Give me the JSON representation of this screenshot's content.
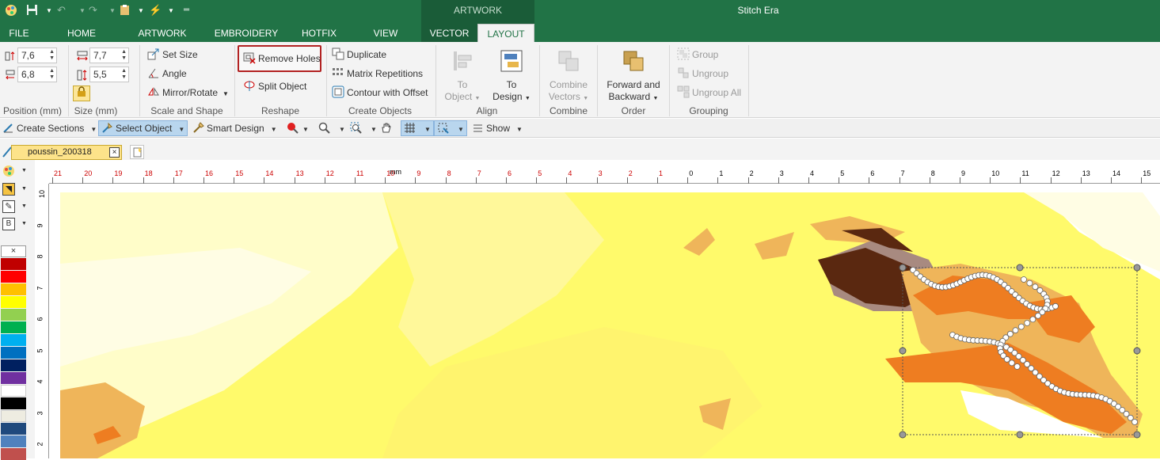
{
  "app": {
    "title": "Stitch Era",
    "context_tab": "ARTWORK"
  },
  "ribbon_tabs": [
    "FILE",
    "HOME",
    "ARTWORK",
    "EMBROIDERY",
    "HOTFIX",
    "VIEW",
    "VECTOR",
    "LAYOUT"
  ],
  "position": {
    "x": "7,6",
    "y": "6,8",
    "label": "Position (mm)"
  },
  "size": {
    "w": "7,7",
    "h": "5,5",
    "label": "Size (mm)"
  },
  "scale_shape": {
    "set_size": "Set Size",
    "angle": "Angle",
    "mirror_rotate": "Mirror/Rotate",
    "label": "Scale and Shape"
  },
  "reshape": {
    "remove_holes": "Remove Holes",
    "split_object": "Split Object",
    "label": "Reshape"
  },
  "create_objects": {
    "duplicate": "Duplicate",
    "matrix": "Matrix Repetitions",
    "contour": "Contour with Offset",
    "label": "Create Objects"
  },
  "align": {
    "to_object_1": "To",
    "to_object_2": "Object",
    "to_design_1": "To",
    "to_design_2": "Design",
    "label": "Align"
  },
  "combine": {
    "btn_1": "Combine",
    "btn_2": "Vectors",
    "label": "Combine"
  },
  "order": {
    "btn_1": "Forward and",
    "btn_2": "Backward",
    "label": "Order"
  },
  "grouping": {
    "group": "Group",
    "ungroup": "Ungroup",
    "ungroup_all": "Ungroup All",
    "label": "Grouping"
  },
  "toolbar": {
    "create_sections": "Create Sections",
    "select_object": "Select Object",
    "smart_design": "Smart Design",
    "show": "Show"
  },
  "document": {
    "tab_name": "poussin_200318"
  },
  "ruler": {
    "unit": "mm",
    "h_labels": [
      "21",
      "20",
      "19",
      "18",
      "17",
      "16",
      "15",
      "14",
      "13",
      "12",
      "11",
      "10",
      "9",
      "8",
      "7",
      "6",
      "5",
      "4",
      "3",
      "2",
      "1",
      "0",
      "1",
      "2",
      "3",
      "4",
      "5",
      "6",
      "7",
      "8",
      "9",
      "10",
      "11",
      "12",
      "13",
      "14",
      "15"
    ],
    "v_labels": [
      "10",
      "9",
      "8",
      "7",
      "6",
      "5",
      "4",
      "3",
      "2"
    ]
  },
  "palette": {
    "none_label": "×",
    "colors": [
      "#c00000",
      "#ff0000",
      "#ffc000",
      "#ffff00",
      "#92d050",
      "#00b050",
      "#00b0f0",
      "#0070c0",
      "#002060",
      "#7030a0",
      "#ffffff",
      "#000000",
      "#eeece1",
      "#1f497d",
      "#4f81bd",
      "#c0504d"
    ]
  }
}
